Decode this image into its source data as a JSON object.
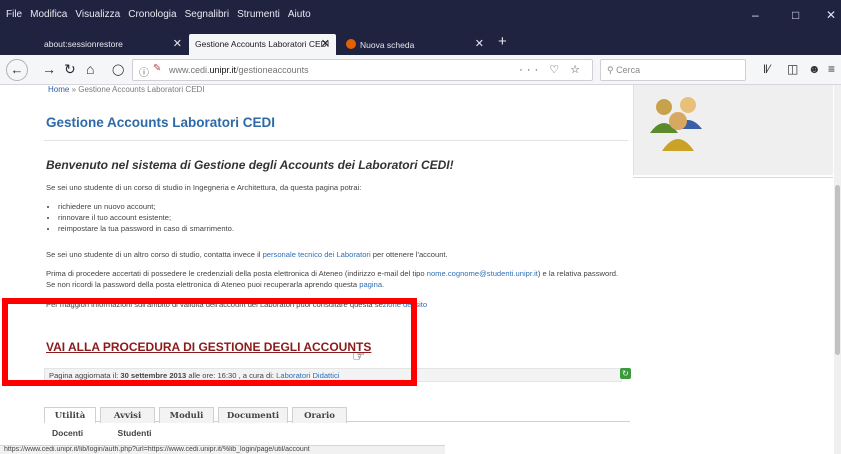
{
  "menubar": {
    "items": [
      "File",
      "Modifica",
      "Visualizza",
      "Cronologia",
      "Segnalibri",
      "Strumenti",
      "Aiuto"
    ]
  },
  "tabs": [
    {
      "label": "about:sessionrestore",
      "active": false
    },
    {
      "label": "Gestione Accounts Laboratori CEDI",
      "active": true
    },
    {
      "label": "Nuova scheda",
      "active": false
    }
  ],
  "navbar": {
    "url_prefix": "www.cedi.",
    "url_domain": "unipr.it",
    "url_path": "/gestioneaccounts",
    "search_placeholder": "Cerca",
    "url_icons": "··· ♡ ☆"
  },
  "page": {
    "breadcrumb_home": "Home",
    "breadcrumb_sep": " » ",
    "breadcrumb_current": "Gestione Accounts Laboratori CEDI",
    "title": "Gestione Accounts Laboratori CEDI",
    "welcome": "Benvenuto nel sistema di Gestione degli Accounts dei Laboratori CEDI!",
    "intro": "Se sei uno studente di un corso di studio in Ingegneria e Architettura, da questa pagina potrai:",
    "options": [
      "richiedere un nuovo account;",
      "rinnovare il tuo account esistente;",
      "reimpostare la tua password in caso di smarrimento."
    ],
    "other_text_1": "Se sei uno studente di un altro corso di studio, contatta invece il ",
    "other_link": "personale tecnico dei Laboratori",
    "other_text_2": " per ottenere l'account.",
    "before_text_1": "Prima di procedere accertati di possedere le credenziali della posta elettronica di Ateneo (indirizzo e-mail del tipo ",
    "before_link": "nome.cognome@studenti.unipr.it",
    "before_text_2": ") e la relativa password. Se non ricordi la password della posta elettronica di Ateneo puoi recuperarla aprendo questa ",
    "before_link_2": "pagina",
    "before_text_3": ".",
    "info_text": "Per maggiori informazioni sull'ambito di validità dell'account dei Laboratori puoi consultare questa se",
    "info_link": "zione del sito",
    "procedure_link": "VAI ALLA PROCEDURA DI GESTIONE DEGLI ACCOUNTS",
    "updated_prefix": "Pagina aggiornata il: ",
    "updated_date": "30 settembre 2013",
    "updated_mid": " alle ore: 16:30 , a cura di: ",
    "updated_author": "Laboratori Didattici"
  },
  "page_tabs": [
    "Utilità",
    "Avvisi",
    "Moduli",
    "Documenti",
    "Orario"
  ],
  "sub_tabs": [
    "Docenti",
    "Studenti"
  ],
  "statusbar": "https://www.cedi.unipr.it/lib/login/auth.php?url=https://www.cedi.unipr.it/%lib_login/page/util/account"
}
